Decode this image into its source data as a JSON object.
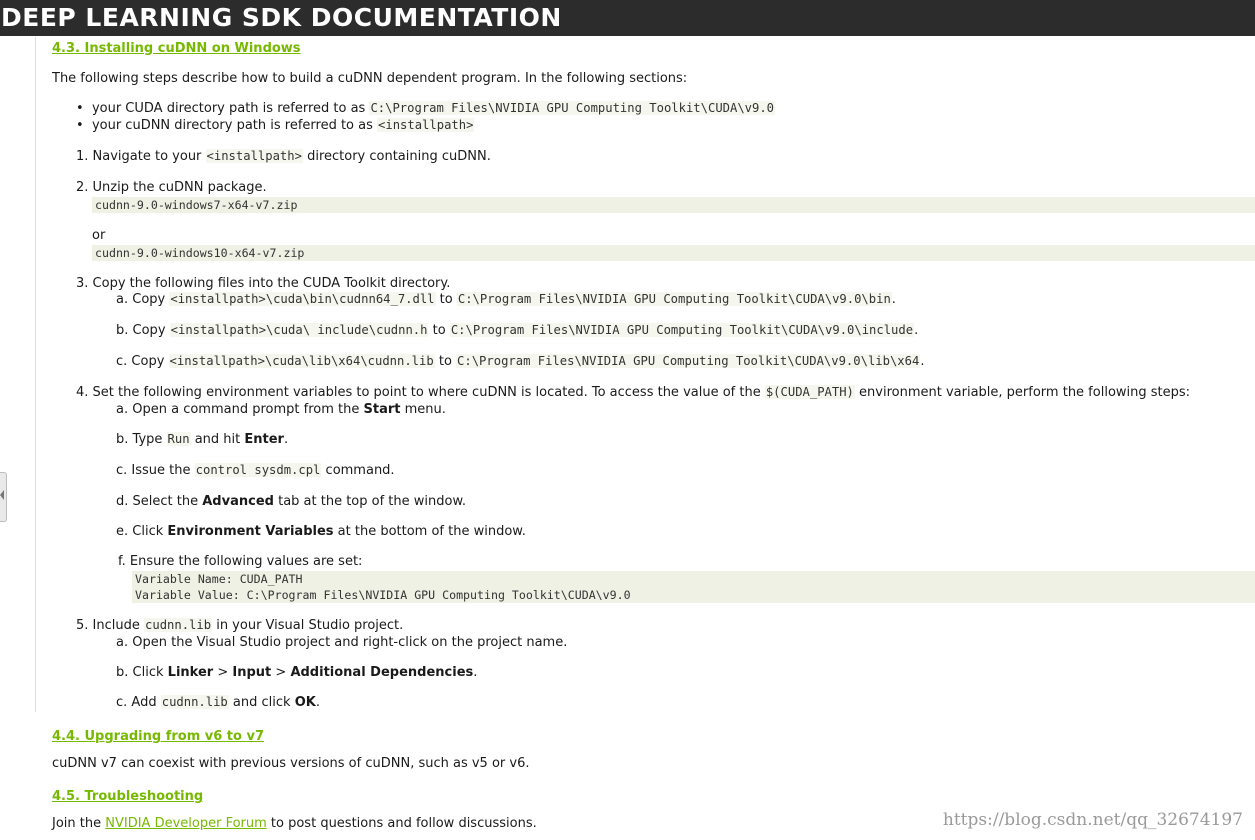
{
  "header": {
    "title": "DEEP LEARNING SDK DOCUMENTATION"
  },
  "s43": {
    "title": "4.3. Installing cuDNN on Windows",
    "intro": "The following steps describe how to build a cuDNN dependent program. In the following sections:",
    "b1_text": "your CUDA directory path is referred to as",
    "b1_code": "C:\\Program Files\\NVIDIA GPU Computing Toolkit\\CUDA\\v9.0",
    "b2_text": "your cuDNN directory path is referred to as",
    "b2_code": "<installpath>",
    "step1_num": "1.",
    "step1_pre": "Navigate to your",
    "step1_code": "<installpath>",
    "step1_post": "directory containing cuDNN.",
    "step2_num": "2.",
    "step2_text": "Unzip the cuDNN package.",
    "step2_zip1": "cudnn-9.0-windows7-x64-v7.zip",
    "step2_or": "or",
    "step2_zip2": "cudnn-9.0-windows10-x64-v7.zip",
    "step3_num": "3.",
    "step3_text": "Copy the following files into the CUDA Toolkit directory.",
    "step3a_l": "a.",
    "step3a_copy": "Copy",
    "step3a_src": "<installpath>\\cuda\\bin\\cudnn64_7.dll",
    "step3a_to": "to",
    "step3a_dst": "C:\\Program Files\\NVIDIA GPU Computing Toolkit\\CUDA\\v9.0\\bin",
    "step3a_end": ".",
    "step3b_l": "b.",
    "step3b_copy": "Copy",
    "step3b_src": "<installpath>\\cuda\\ include\\cudnn.h",
    "step3b_to": "to",
    "step3b_dst": "C:\\Program Files\\NVIDIA GPU Computing Toolkit\\CUDA\\v9.0\\include",
    "step3b_end": ".",
    "step3c_l": "c.",
    "step3c_copy": "Copy",
    "step3c_src": "<installpath>\\cuda\\lib\\x64\\cudnn.lib",
    "step3c_to": "to",
    "step3c_dst": "C:\\Program Files\\NVIDIA GPU Computing Toolkit\\CUDA\\v9.0\\lib\\x64",
    "step3c_end": ".",
    "step4_num": "4.",
    "step4_pre": "Set the following environment variables to point to where cuDNN is located. To access the value of the",
    "step4_code": "$(CUDA_PATH)",
    "step4_post": "environment variable, perform the following steps:",
    "step4a_l": "a.",
    "step4a_pre": "Open a command prompt from the",
    "step4a_b": "Start",
    "step4a_post": "menu.",
    "step4b_l": "b.",
    "step4b_pre": "Type",
    "step4b_code": "Run",
    "step4b_mid": "and hit",
    "step4b_b": "Enter",
    "step4b_end": ".",
    "step4c_l": "c.",
    "step4c_pre": "Issue the",
    "step4c_code": "control sysdm.cpl",
    "step4c_post": "command.",
    "step4d_l": "d.",
    "step4d_pre": "Select the",
    "step4d_b": "Advanced",
    "step4d_post": "tab at the top of the window.",
    "step4e_l": "e.",
    "step4e_pre": "Click",
    "step4e_b": "Environment Variables",
    "step4e_post": "at the bottom of the window.",
    "step4f_l": "f.",
    "step4f_text": "Ensure the following values are set:",
    "step4f_line1": "Variable Name: CUDA_PATH",
    "step4f_line2": "Variable Value: C:\\Program Files\\NVIDIA GPU Computing Toolkit\\CUDA\\v9.0",
    "step5_num": "5.",
    "step5_pre": "Include",
    "step5_code": "cudnn.lib",
    "step5_post": "in your Visual Studio project.",
    "step5a_l": "a.",
    "step5a_text": "Open the Visual Studio project and right-click on the project name.",
    "step5b_l": "b.",
    "step5b_pre": "Click",
    "step5b_b1": "Linker",
    "step5b_sep1": ">",
    "step5b_b2": "Input",
    "step5b_sep2": ">",
    "step5b_b3": "Additional Dependencies",
    "step5b_end": ".",
    "step5c_l": "c.",
    "step5c_pre": "Add",
    "step5c_code": "cudnn.lib",
    "step5c_mid": "and click",
    "step5c_b": "OK",
    "step5c_end": "."
  },
  "s44": {
    "title": "4.4. Upgrading from v6 to v7",
    "text": "cuDNN v7 can coexist with previous versions of cuDNN, such as v5 or v6."
  },
  "s45": {
    "title": "4.5. Troubleshooting",
    "pre": "Join the",
    "link": "NVIDIA Developer Forum",
    "post": "to post questions and follow discussions."
  },
  "watermark": "https://blog.csdn.net/qq_32674197"
}
